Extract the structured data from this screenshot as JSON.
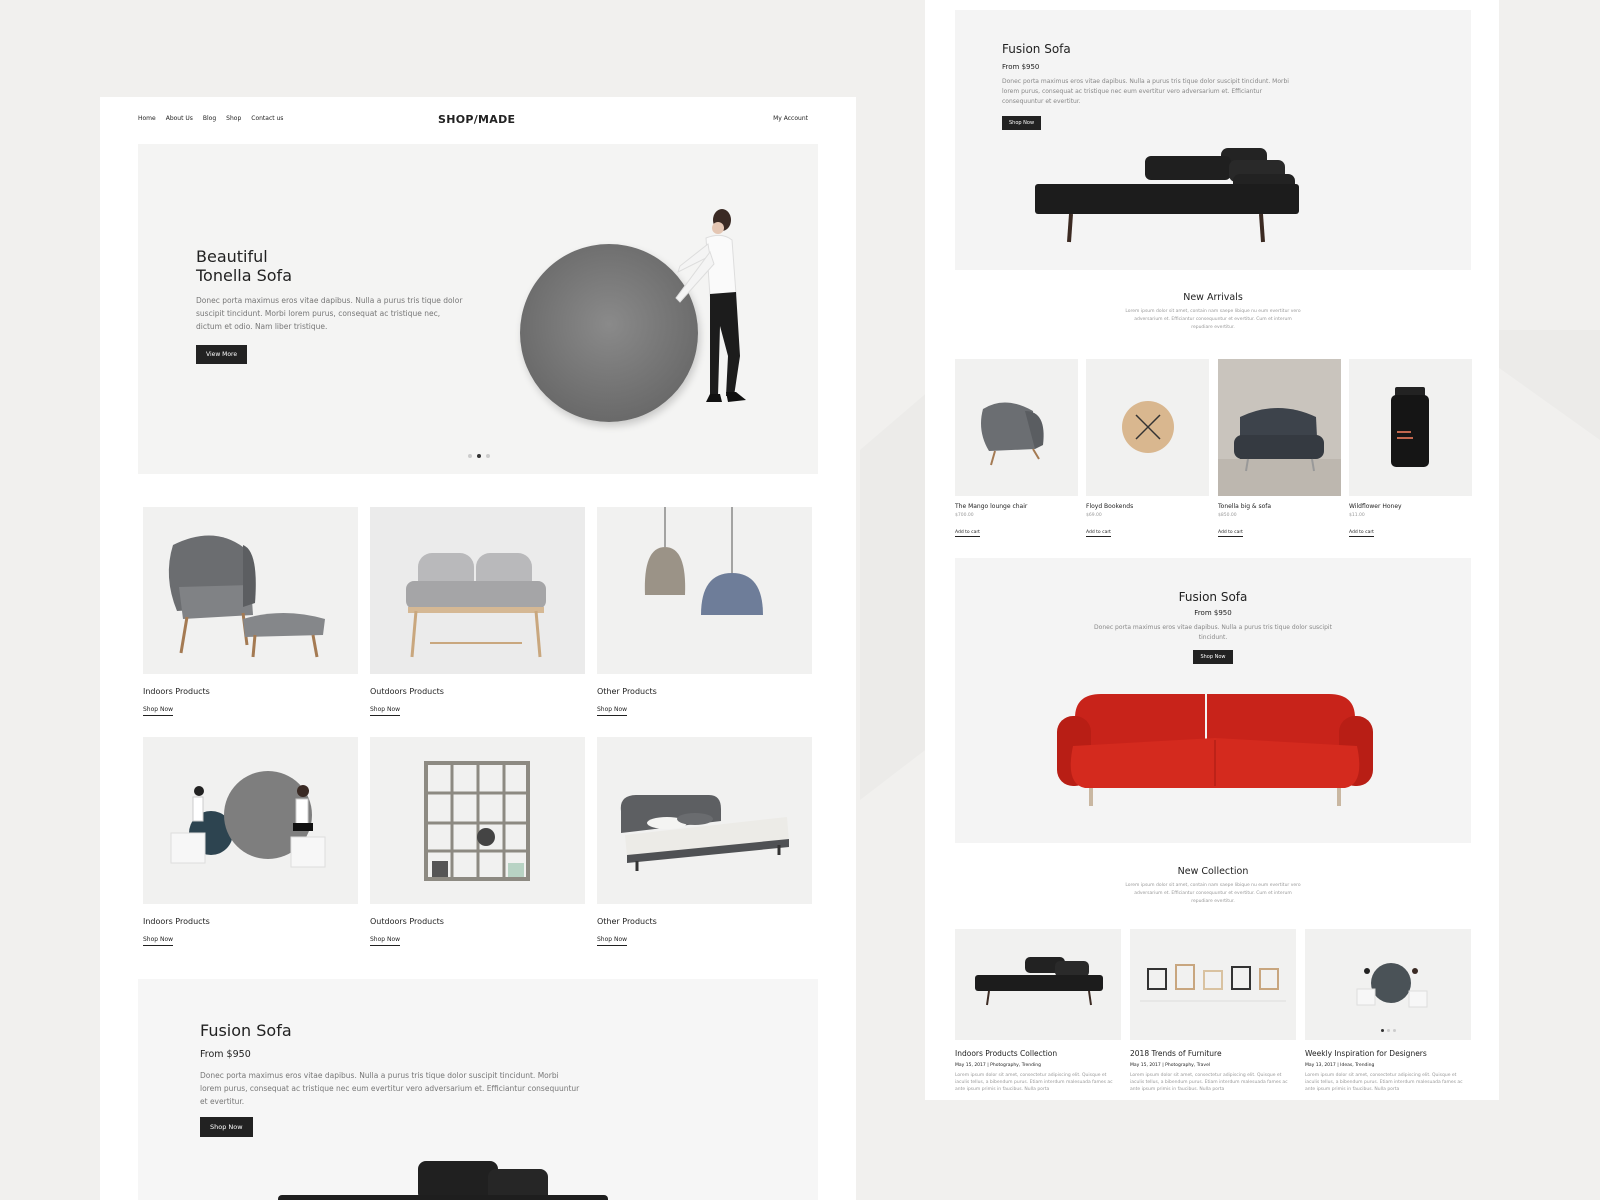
{
  "left": {
    "nav": {
      "links": [
        "Home",
        "About Us",
        "Blog",
        "Shop",
        "Contact us"
      ],
      "logo": "SHOP/MADE",
      "account": "My Account"
    },
    "hero": {
      "title_line1": "Beautiful",
      "title_line2": "Tonella Sofa",
      "text": "Donec porta maximus eros vitae dapibus. Nulla a purus tris tique dolor suscipit tincidunt. Morbi lorem purus, consequat ac tristique nec, dictum et odio. Nam liber tristique.",
      "button": "View More",
      "slides": 3,
      "active_slide": 2
    },
    "categories": [
      {
        "title": "Indoors Products",
        "link": "Shop Now",
        "icon": "armchair-ottoman"
      },
      {
        "title": "Outdoors Products",
        "link": "Shop Now",
        "icon": "loveseat"
      },
      {
        "title": "Other Products",
        "link": "Shop Now",
        "icon": "pendant-lamps"
      },
      {
        "title": "Indoors Products",
        "link": "Shop Now",
        "icon": "people-disc"
      },
      {
        "title": "Outdoors Products",
        "link": "Shop Now",
        "icon": "bookshelf"
      },
      {
        "title": "Other Products",
        "link": "Shop Now",
        "icon": "bed"
      }
    ],
    "promo": {
      "title": "Fusion Sofa",
      "price": "From $950",
      "text": "Donec porta maximus eros vitae dapibus. Nulla a purus tris tique dolor suscipit tincidunt. Morbi lorem purus, consequat ac tristique nec eum evertitur vero adversarium et. Efficiantur consequuntur et evertitur.",
      "button": "Shop Now"
    }
  },
  "right": {
    "promo1": {
      "title": "Fusion Sofa",
      "price": "From $950",
      "text": "Donec porta maximus eros vitae dapibus. Nulla a purus tris tique dolor suscipit tincidunt. Morbi lorem purus, consequat ac tristique nec eum evertitur vero adversarium et. Efficiantur consequuntur et evertitur.",
      "button": "Shop Now"
    },
    "new_arrivals": {
      "title": "New Arrivals",
      "text": "Lorem ipsum dolor sit amet, contain nam saepe libique nu eum evertitur vero adversarium et. Efficiantur consequuntur et evertitur. Cum et interum repudiare evertitur.",
      "items": [
        {
          "name": "The Mango lounge chair",
          "price": "$700.00",
          "link": "Add to cart"
        },
        {
          "name": "Floyd Bookends",
          "price": "$69.00",
          "link": "Add to cart"
        },
        {
          "name": "Tonella big & sofa",
          "price": "$850.00",
          "link": "Add to cart"
        },
        {
          "name": "Wildflower Honey",
          "price": "$11.00",
          "link": "Add to cart"
        }
      ]
    },
    "promo2": {
      "title": "Fusion Sofa",
      "price": "From $950",
      "text": "Donec porta maximus eros vitae dapibus. Nulla a purus tris tique dolor suscipit tincidunt.",
      "button": "Shop Now"
    },
    "new_collection": {
      "title": "New Collection",
      "text": "Lorem ipsum dolor sit amet, contain nam saepe libique nu eum evertitur vero adversarium et. Efficiantur consequuntur et evertitur. Cum et interum repudiare evertitur.",
      "posts": [
        {
          "title": "Indoors Products Collection",
          "date": "May 15, 2017",
          "tags": "Photography, Trending",
          "excerpt": "Lorem ipsum dolor sit amet, consectetur adipiscing elit. Quisque et iaculis tellus, a bibendum purus. Etiam interdum malesuada fames ac ante ipsum primis in faucibus. Nulla porta"
        },
        {
          "title": "2018 Trends of Furniture",
          "date": "May 15, 2017",
          "tags": "Photography, Travel",
          "excerpt": "Lorem ipsum dolor sit amet, consectetur adipiscing elit. Quisque et iaculis tellus, a bibendum purus. Etiam interdum malesuada fames ac ante ipsum primis in faucibus. Nulla porta"
        },
        {
          "title": "Weekly Inspiration for Designers",
          "date": "May 13, 2017",
          "tags": "Ideas, Trending",
          "excerpt": "Lorem ipsum dolor sit amet, consectetur adipiscing elit. Quisque et iaculis tellus, a bibendum purus. Etiam interdum malesuada fames ac ante ipsum primis in faucibus. Nulla porta"
        }
      ]
    }
  },
  "colors": {
    "dark": "#222222",
    "card_bg": "#f1f1f0",
    "sofa_red": "#d42a1e",
    "page_bg": "#f1f0ee"
  }
}
